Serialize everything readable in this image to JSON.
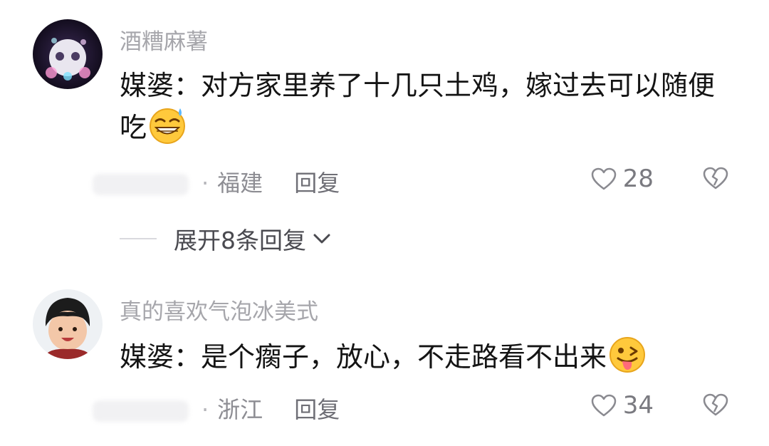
{
  "comments": [
    {
      "username": "酒糟麻薯",
      "text": "媒婆：对方家里养了十几只土鸡，嫁过去可以随便吃",
      "emoji": "grinning-sweat-emoji",
      "location": "福建",
      "reply_label": "回复",
      "likes": "28",
      "expand_label": "展开8条回复"
    },
    {
      "username": "真的喜欢气泡冰美式",
      "text": "媒婆：是个瘸子，放心，不走路看不出来",
      "emoji": "winking-tongue-emoji",
      "location": "浙江",
      "reply_label": "回复",
      "likes": "34"
    }
  ],
  "icons": {
    "like": "heart-outline-icon",
    "dislike": "broken-heart-icon",
    "expand": "chevron-down-icon"
  }
}
